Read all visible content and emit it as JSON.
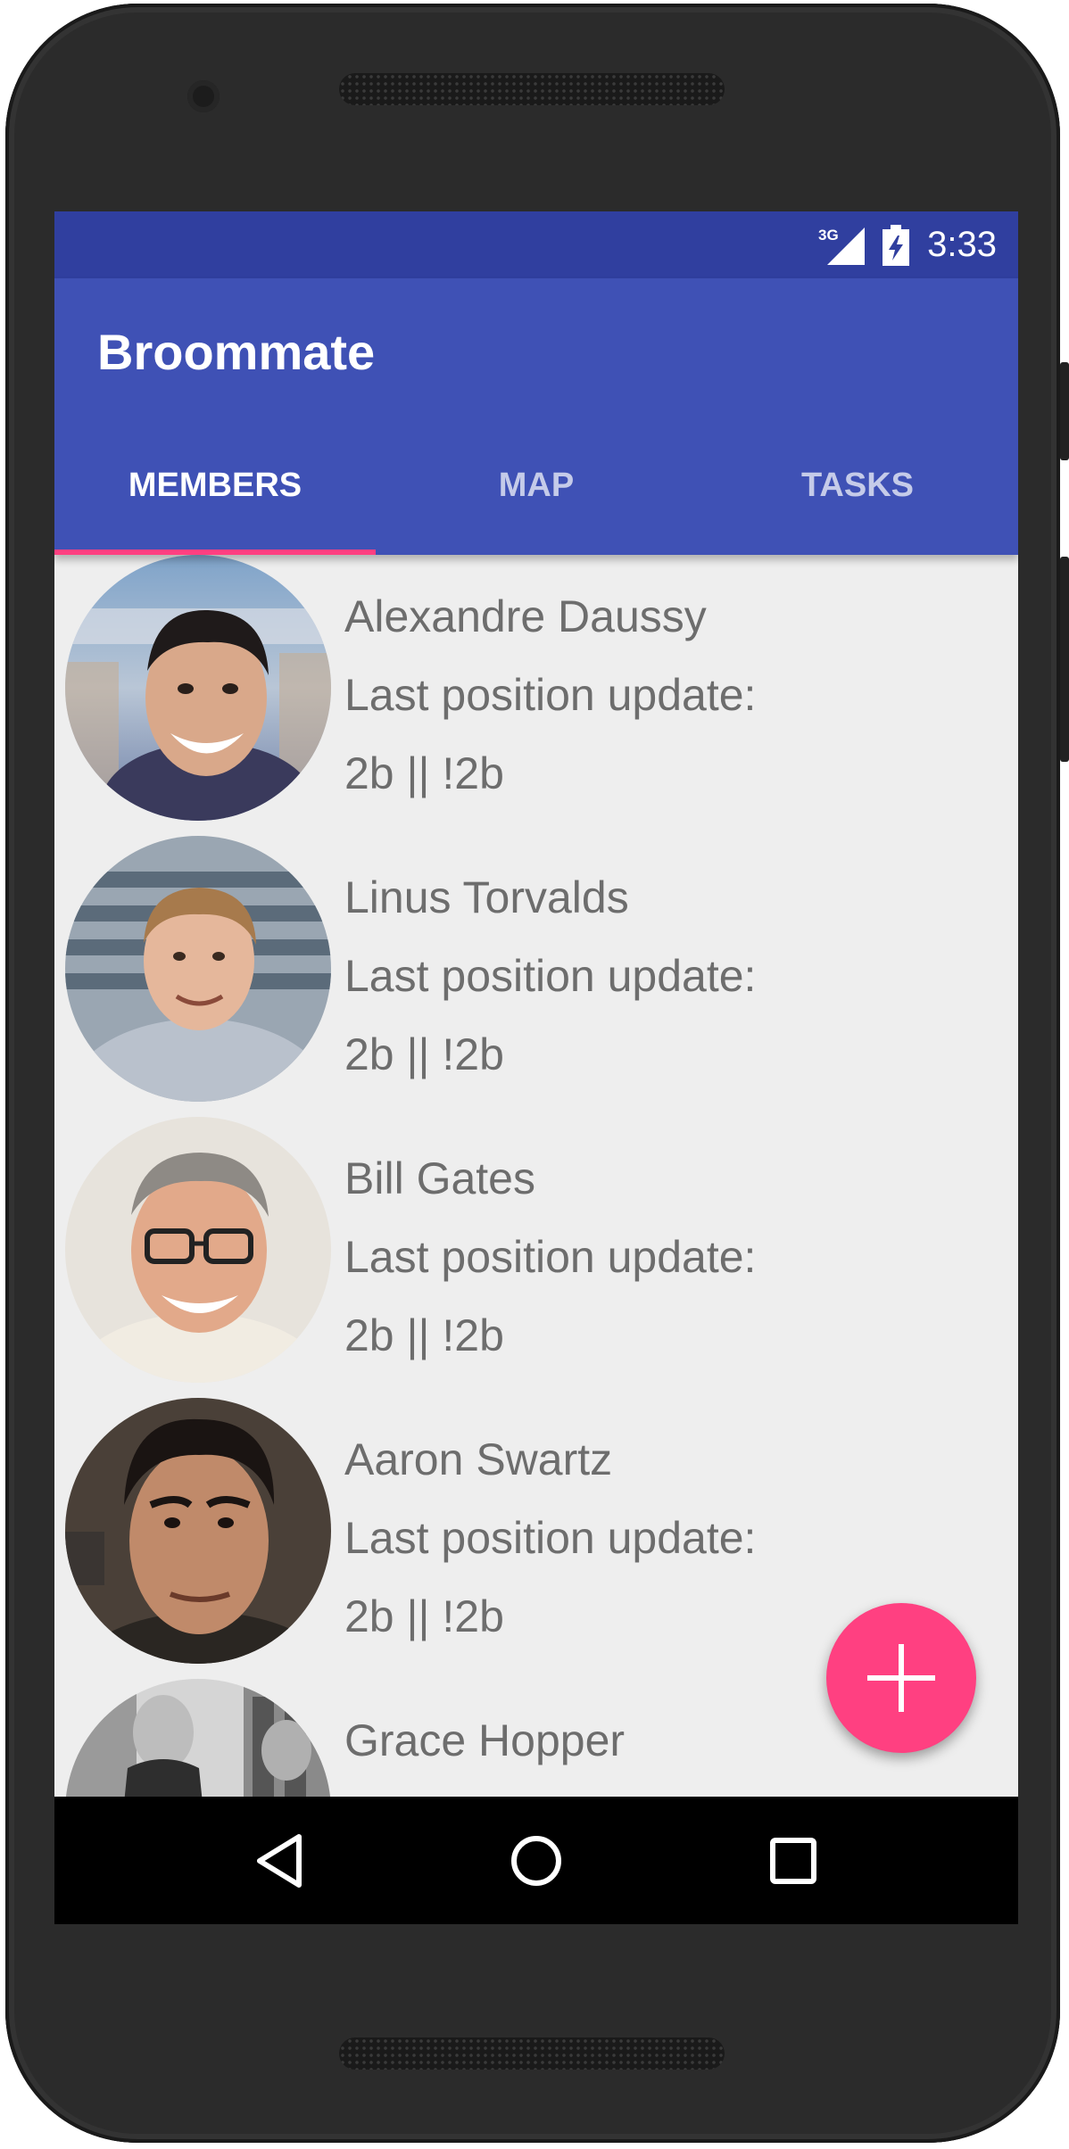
{
  "status_bar": {
    "network": "3G",
    "time": "3:33"
  },
  "app_bar": {
    "title": "Broommate"
  },
  "tabs": [
    {
      "label": "MEMBERS",
      "active": true
    },
    {
      "label": "MAP",
      "active": false
    },
    {
      "label": "TASKS",
      "active": false
    }
  ],
  "members": [
    {
      "name": "Alexandre Daussy",
      "line1": "Last position update:",
      "line2": "2b || !2b",
      "avatar": "avatar-photo"
    },
    {
      "name": "Linus Torvalds",
      "line1": "Last position update:",
      "line2": "2b || !2b",
      "avatar": "avatar-photo"
    },
    {
      "name": "Bill Gates",
      "line1": "Last position update:",
      "line2": "2b || !2b",
      "avatar": "avatar-photo"
    },
    {
      "name": "Aaron Swartz",
      "line1": "Last position update:",
      "line2": "2b || !2b",
      "avatar": "avatar-photo"
    },
    {
      "name": "Grace Hopper",
      "line1": "",
      "line2": "",
      "avatar": "avatar-photo"
    }
  ],
  "fab": {
    "icon": "plus-icon"
  },
  "nav": {
    "back_icon": "back-triangle-icon",
    "home_icon": "home-circle-icon",
    "recents_icon": "recents-square-icon"
  },
  "colors": {
    "primary": "#3f51b5",
    "primary_dark": "#303f9f",
    "accent": "#ff4081",
    "background": "#eeeeee",
    "text": "#6d6d6d"
  }
}
